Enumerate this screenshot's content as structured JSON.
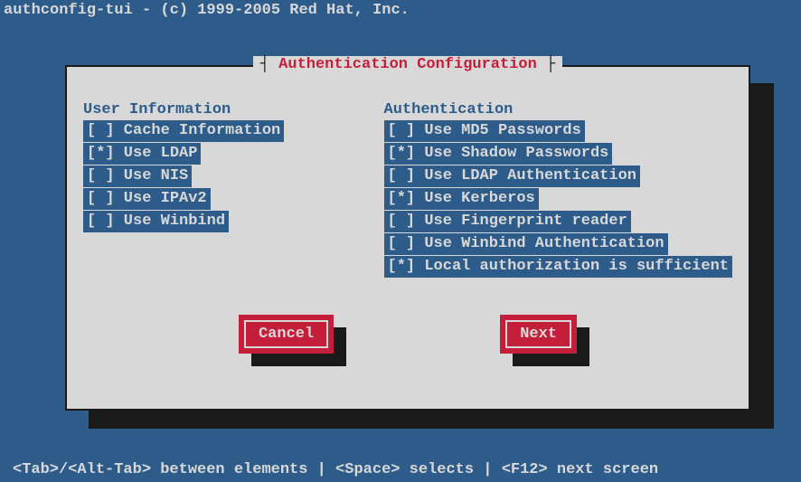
{
  "title": "authconfig-tui - (c) 1999-2005 Red Hat, Inc.",
  "dialog": {
    "title": "Authentication Configuration",
    "left_heading": "User Information",
    "right_heading": "Authentication",
    "left_items": [
      {
        "checked": false,
        "label": "Cache Information"
      },
      {
        "checked": true,
        "label": "Use LDAP"
      },
      {
        "checked": false,
        "label": "Use NIS"
      },
      {
        "checked": false,
        "label": "Use IPAv2"
      },
      {
        "checked": false,
        "label": "Use Winbind"
      }
    ],
    "right_items": [
      {
        "checked": false,
        "label": "Use MD5 Passwords"
      },
      {
        "checked": true,
        "label": "Use Shadow Passwords"
      },
      {
        "checked": false,
        "label": "Use LDAP Authentication"
      },
      {
        "checked": true,
        "label": "Use Kerberos"
      },
      {
        "checked": false,
        "label": "Use Fingerprint reader"
      },
      {
        "checked": false,
        "label": "Use Winbind Authentication"
      },
      {
        "checked": true,
        "label": "Local authorization is sufficient"
      }
    ],
    "cancel": "Cancel",
    "next": "Next"
  },
  "footer": "<Tab>/<Alt-Tab> between elements   |   <Space> selects   |  <F12> next screen"
}
